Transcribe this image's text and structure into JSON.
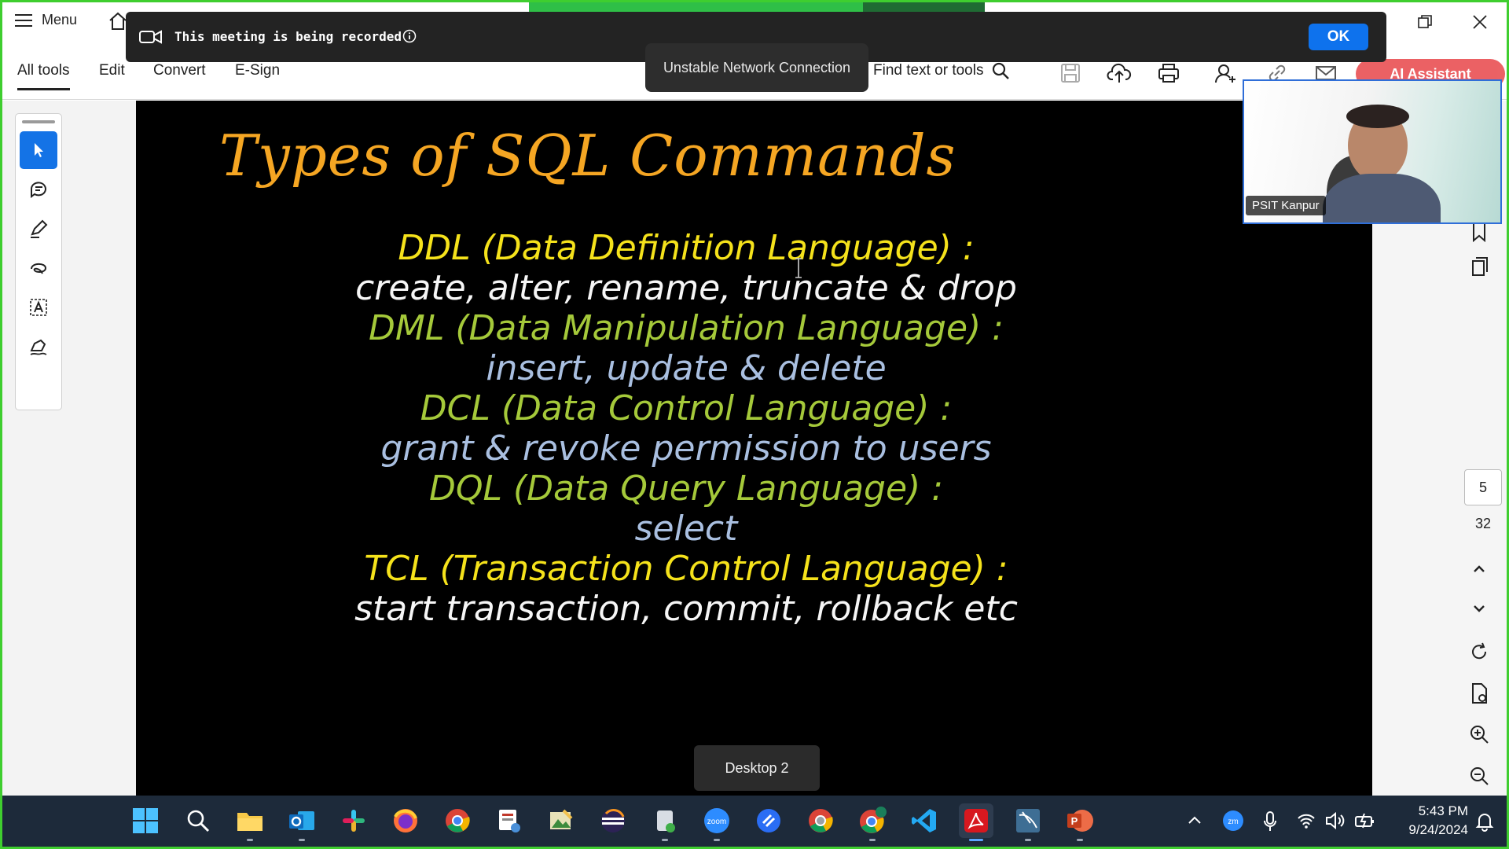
{
  "window": {
    "menu_label": "Menu",
    "controls": [
      "restore",
      "close"
    ]
  },
  "toolbar": {
    "tabs": [
      {
        "label": "All tools",
        "active": true
      },
      {
        "label": "Edit",
        "active": false
      },
      {
        "label": "Convert",
        "active": false
      },
      {
        "label": "E-Sign",
        "active": false
      }
    ],
    "find_label": "Find text or tools",
    "ai_label": "AI Assistant"
  },
  "recording_banner": {
    "text": "This meeting is being recorded",
    "ok_label": "OK"
  },
  "network_toast": "Unstable Network Connection",
  "slide": {
    "title": "Types of SQL Commands",
    "lines": [
      {
        "text": "DDL (Data Definition Language) :",
        "color": "yellow"
      },
      {
        "text": "create, alter, rename, truncate & drop",
        "color": "white"
      },
      {
        "text": "DML (Data Manipulation Language) :",
        "color": "green"
      },
      {
        "text": "insert, update & delete",
        "color": "blue"
      },
      {
        "text": "DCL (Data Control Language) :",
        "color": "green"
      },
      {
        "text": "grant & revoke permission to users",
        "color": "blue"
      },
      {
        "text": "DQL (Data Query Language) :",
        "color": "green"
      },
      {
        "text": "select",
        "color": "blue"
      },
      {
        "text": "TCL (Transaction Control Language) :",
        "color": "yellow"
      },
      {
        "text": "start transaction, commit, rollback etc",
        "color": "white"
      }
    ]
  },
  "desktop_toast": "Desktop 2",
  "page_nav": {
    "current": "5",
    "total": "32"
  },
  "video": {
    "participant_name": "PSIT Kanpur"
  },
  "taskbar": {
    "apps": [
      "start",
      "search",
      "file-explorer",
      "outlook",
      "slack",
      "firefox",
      "chrome",
      "snipping-tool",
      "image-viewer",
      "eclipse",
      "disk-tool",
      "zoom",
      "scaler",
      "chrome-2",
      "chrome-3",
      "vscode",
      "acrobat",
      "mysql-workbench",
      "powerpoint"
    ],
    "active_app": "acrobat",
    "time": "5:43 PM",
    "date": "9/24/2024"
  }
}
